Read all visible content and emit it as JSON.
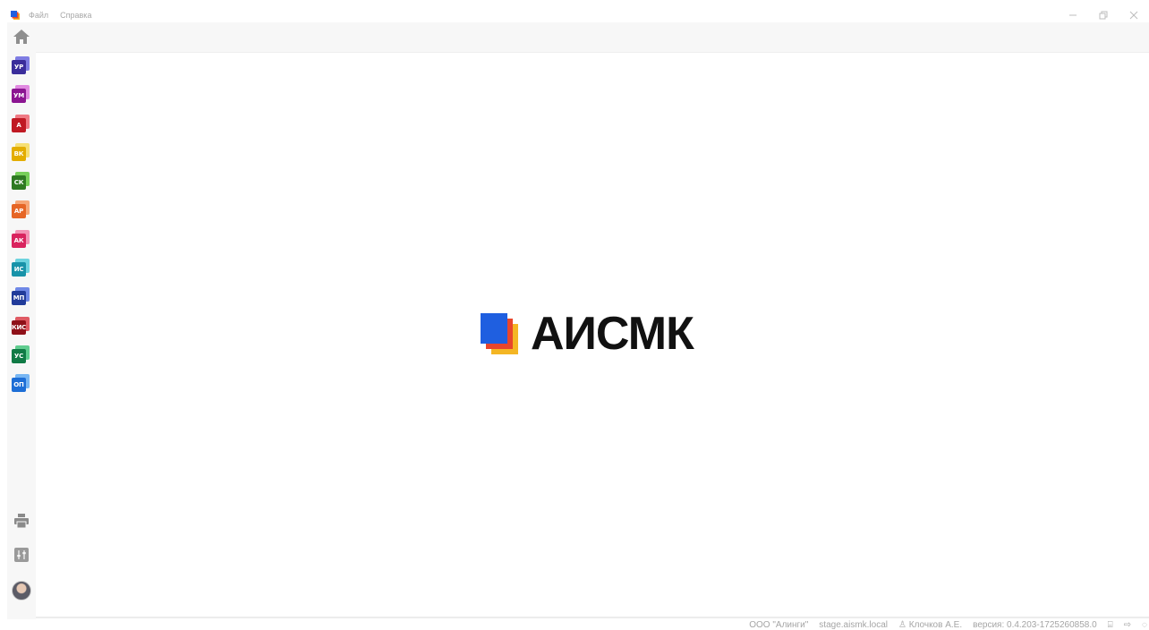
{
  "menu": {
    "file": "Файл",
    "help": "Справка"
  },
  "window_controls": [
    "minimize-icon",
    "restore-icon",
    "close-icon"
  ],
  "sidebar": {
    "home": {
      "icon": "home-icon"
    },
    "modules": [
      {
        "code": "УР",
        "front": "#3a2d9b",
        "back": "#7f7de3"
      },
      {
        "code": "УМ",
        "front": "#8b1591",
        "back": "#e089e0"
      },
      {
        "code": "А",
        "front": "#c01923",
        "back": "#ef7a84"
      },
      {
        "code": "ВК",
        "front": "#e3ad00",
        "back": "#f6df74"
      },
      {
        "code": "СК",
        "front": "#2f7a22",
        "back": "#77cf59"
      },
      {
        "code": "АР",
        "front": "#e66626",
        "back": "#f6a777"
      },
      {
        "code": "АК",
        "front": "#d9245f",
        "back": "#f293b5"
      },
      {
        "code": "ИС",
        "front": "#1893a9",
        "back": "#6dd3df"
      },
      {
        "code": "МП",
        "front": "#213b9a",
        "back": "#6f88e6"
      },
      {
        "code": "КИС",
        "front": "#8f1018",
        "back": "#df5a63"
      },
      {
        "code": "УС",
        "front": "#107a45",
        "back": "#5fcc8f"
      },
      {
        "code": "ОП",
        "front": "#1d6ed6",
        "back": "#78b6f3"
      }
    ],
    "bottom": [
      "printer-icon",
      "settings-icon",
      "user-avatar"
    ]
  },
  "hero": {
    "text": "АИСМК",
    "colors": {
      "blue": "#1f5fe0",
      "red": "#e8452c",
      "yellow": "#f4b624"
    }
  },
  "status": {
    "company": "ООО \"Алинги\"",
    "server": "stage.aismk.local",
    "user": "Клочков А.Е.",
    "version": "версия: 0.4.203-1725260858.0"
  }
}
